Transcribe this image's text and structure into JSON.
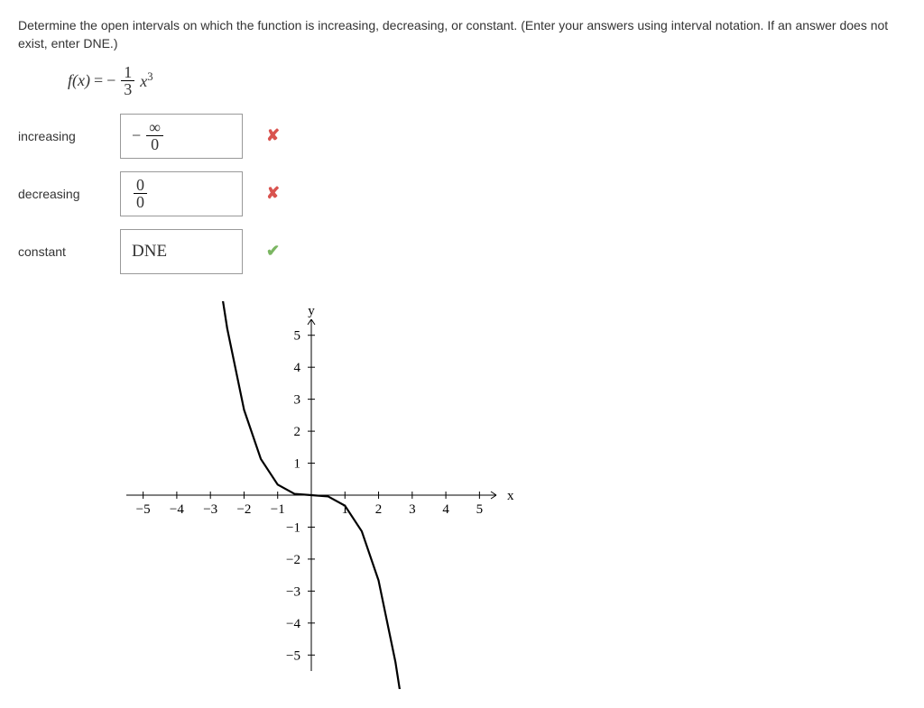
{
  "question": "Determine the open intervals on which the function is increasing, decreasing, or constant. (Enter your answers using interval notation. If an answer does not exist, enter DNE.)",
  "function": {
    "lhs": "f(x)",
    "equals": "=",
    "neg": "−",
    "frac_num": "1",
    "frac_den": "3",
    "xvar": "x",
    "exp": "3"
  },
  "rows": {
    "increasing": {
      "label": "increasing",
      "type": "frac",
      "prefix": "−",
      "num": "∞",
      "den": "0",
      "correct": false
    },
    "decreasing": {
      "label": "decreasing",
      "type": "frac",
      "prefix": "",
      "num": "0",
      "den": "0",
      "correct": false
    },
    "constant": {
      "label": "constant",
      "type": "text",
      "value": "DNE",
      "correct": true
    }
  },
  "marks": {
    "wrong": "✘",
    "correct": "✔"
  },
  "chart_data": {
    "type": "line",
    "title": "",
    "xlabel": "x",
    "ylabel": "y",
    "xlim": [
      -5.5,
      5.5
    ],
    "ylim": [
      -5.5,
      5.5
    ],
    "xticks": [
      -5,
      -4,
      -3,
      -2,
      -1,
      1,
      2,
      3,
      4,
      5
    ],
    "yticks": [
      -5,
      -4,
      -3,
      -2,
      -1,
      1,
      2,
      3,
      4,
      5
    ],
    "series": [
      {
        "name": "f(x) = -(1/3)x^3",
        "points": [
          {
            "x": -2.7,
            "y": 6.56
          },
          {
            "x": -2.5,
            "y": 5.21
          },
          {
            "x": -2.0,
            "y": 2.67
          },
          {
            "x": -1.5,
            "y": 1.13
          },
          {
            "x": -1.0,
            "y": 0.33
          },
          {
            "x": -0.5,
            "y": 0.04
          },
          {
            "x": 0.0,
            "y": 0.0
          },
          {
            "x": 0.5,
            "y": -0.04
          },
          {
            "x": 1.0,
            "y": -0.33
          },
          {
            "x": 1.5,
            "y": -1.13
          },
          {
            "x": 2.0,
            "y": -2.67
          },
          {
            "x": 2.5,
            "y": -5.21
          },
          {
            "x": 2.7,
            "y": -6.56
          }
        ]
      }
    ]
  }
}
